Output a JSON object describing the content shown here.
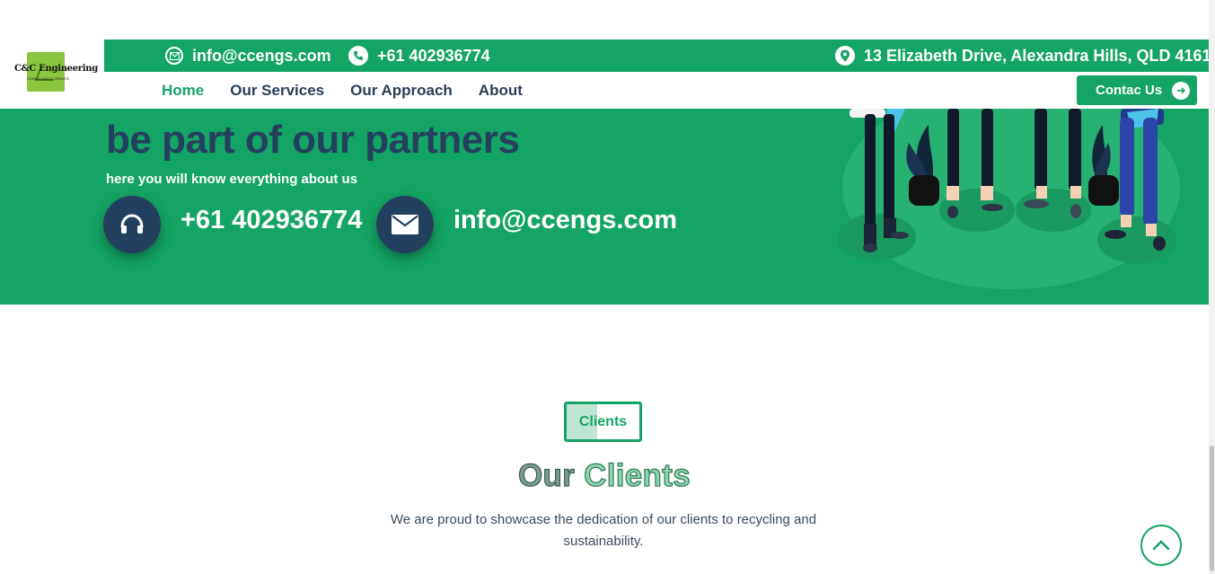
{
  "brand": {
    "name": "C&C Engineering",
    "tagline": "CONSULTANTS GRANTS",
    "logo_color": "#8cc63f"
  },
  "topbar": {
    "email": "info@ccengs.com",
    "phone": "+61 402936774",
    "address": "13 Elizabeth Drive, Alexandra Hills, QLD 4161",
    "icons": {
      "email": "envelope-icon",
      "phone": "phone-icon",
      "address": "map-pin-icon"
    }
  },
  "nav": {
    "items": [
      {
        "label": "Home",
        "active": true
      },
      {
        "label": "Our Services",
        "active": false
      },
      {
        "label": "Our Approach",
        "active": false
      },
      {
        "label": "About",
        "active": false
      }
    ],
    "contact_button": "Contac Us"
  },
  "hero": {
    "title": "be part of our partners",
    "subtitle": "here you will know everything about us",
    "phone": "+61 402936774",
    "email": "info@ccengs.com",
    "icons": {
      "phone": "headset-icon",
      "email": "envelope-icon"
    }
  },
  "clients": {
    "badge": "Clients",
    "title_part1": "Our",
    "title_part2": "Clients",
    "description": "We are proud to showcase the dedication of our clients to recycling and sustainability."
  },
  "colors": {
    "primary": "#14a465",
    "navy": "#24405f",
    "text": "#2b3d59"
  }
}
